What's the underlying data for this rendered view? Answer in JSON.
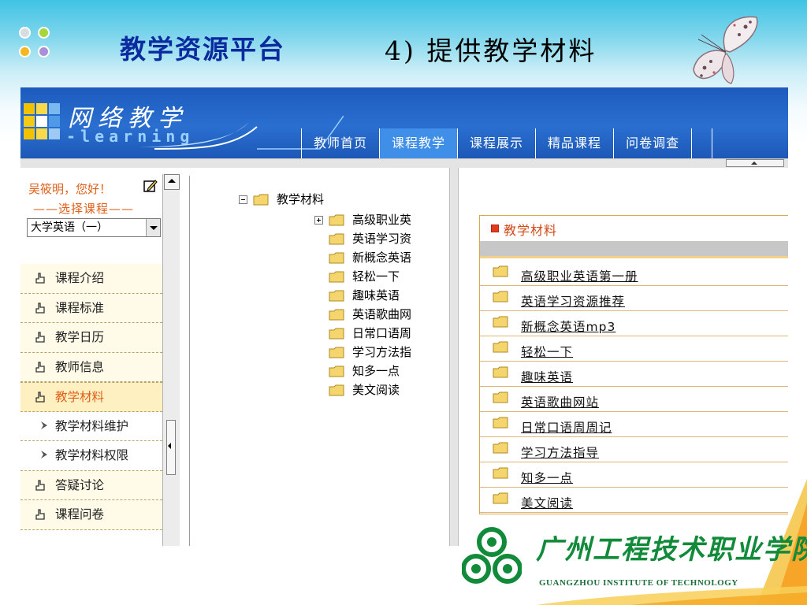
{
  "slide": {
    "title": "教学资源平台",
    "subtitle": "4) 提供教学材料"
  },
  "colors": {
    "slide_title": "#0a2a9e",
    "header_blue": "#2a6fd0",
    "nav_active": "#3f8fe8",
    "accent_orange": "#e0601a",
    "panel_border": "#d6a850",
    "school_green": "#118a3a"
  },
  "app": {
    "logo_cn": "网络教学",
    "logo_en": "-learning",
    "nav": [
      {
        "label": "教师首页"
      },
      {
        "label": "课程教学"
      },
      {
        "label": "课程展示"
      },
      {
        "label": "精品课程"
      },
      {
        "label": "问卷调查"
      }
    ],
    "active_nav_index": 1
  },
  "sidebar": {
    "greeting": "吴筱明，您好！",
    "choose_course": "——选择课程——",
    "course_selected": "大学英语（一）",
    "menu": [
      {
        "label": "课程介绍",
        "icon": "hand-pointer-icon"
      },
      {
        "label": "课程标准",
        "icon": "hand-pointer-icon"
      },
      {
        "label": "教学日历",
        "icon": "hand-pointer-icon"
      },
      {
        "label": "教师信息",
        "icon": "hand-pointer-icon"
      },
      {
        "label": "教学材料",
        "icon": "hand-pointer-icon",
        "active": true
      },
      {
        "label": "教学材料维护",
        "icon": "sub-arrow-icon",
        "sub": true
      },
      {
        "label": "教学材料权限",
        "icon": "sub-arrow-icon",
        "sub": true
      },
      {
        "label": "答疑讨论",
        "icon": "hand-pointer-icon"
      },
      {
        "label": "课程问卷",
        "icon": "hand-pointer-icon"
      }
    ]
  },
  "tree": {
    "root": "教学材料",
    "items": [
      {
        "label": "高级职业英",
        "expandable": true
      },
      {
        "label": "英语学习资"
      },
      {
        "label": "新概念英语"
      },
      {
        "label": "轻松一下"
      },
      {
        "label": "趣味英语"
      },
      {
        "label": "英语歌曲网"
      },
      {
        "label": "日常口语周"
      },
      {
        "label": "学习方法指"
      },
      {
        "label": "知多一点"
      },
      {
        "label": "美文阅读"
      }
    ]
  },
  "materials": {
    "title": "教学材料",
    "items": [
      "高级职业英语第一册",
      "英语学习资源推荐",
      "新概念英语mp3",
      "轻松一下",
      "趣味英语",
      "英语歌曲网站",
      "日常口语周周记",
      "学习方法指导",
      "知多一点",
      "美文阅读"
    ]
  },
  "school": {
    "name_cn": "广州工程技术职业学院",
    "name_en": "GUANGZHOU INSTITUTE OF TECHNOLOGY"
  }
}
